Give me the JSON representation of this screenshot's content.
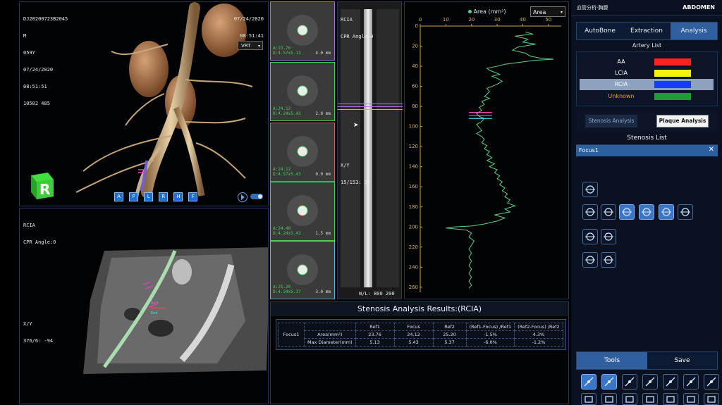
{
  "vrt": {
    "patient_id": "DJ20200723B2045",
    "sex": "M",
    "age": "059Y",
    "date_left": "07/24/2020",
    "time_left": "08:51:51",
    "series": "10502 485",
    "date_right": "07/24/2020",
    "time_right": "08:51:41",
    "mode_select": "VRT",
    "orientation_buttons": [
      "A",
      "P",
      "L",
      "R",
      "H",
      "F"
    ],
    "cube_label": "R"
  },
  "cpr_left": {
    "title": "RCIA",
    "angle": "CPR Angle:0",
    "xy_label": "X/Y",
    "xy_value": "376/6: -94",
    "marker_labels": [
      "Ref1",
      "Stenosis",
      "End"
    ]
  },
  "cross_sections": [
    {
      "line1": "A:23.76",
      "line2": "D:4.57x5.13",
      "mm": "4.0 mm"
    },
    {
      "line1": "A:24.12",
      "line2": "D:4.24x5.43",
      "mm": "2.0 mm"
    },
    {
      "line1": "A:24.12",
      "line2": "D:4.57x5.43",
      "mm": "0.0 mm"
    },
    {
      "line1": "A:24.48",
      "line2": "D:4.24x5.43",
      "mm": "1.5 mm"
    },
    {
      "line1": "A:25.20",
      "line2": "D:4.24x5.37",
      "mm": "3.0 mm"
    }
  ],
  "cpr_straight": {
    "title": "RCIA",
    "angle": "CPR Angle:0",
    "xy_label": "X/Y",
    "xy_value": "15/153: 32",
    "wl": "W/L: 800 200"
  },
  "graph": {
    "legend": "Area (mm²)",
    "select": "Area",
    "x_ticks": [
      0,
      10,
      20,
      30,
      40,
      50
    ],
    "y_ticks": [
      0,
      20,
      40,
      60,
      80,
      100,
      120,
      140,
      160,
      180,
      200,
      220,
      240,
      260
    ],
    "line_color": "#5fcf8a"
  },
  "chart_data": {
    "type": "line",
    "title": "",
    "xlabel": "Area (mm²)",
    "ylabel": "",
    "xlim": [
      0,
      55
    ],
    "ylim": [
      0,
      265
    ],
    "series": [
      {
        "name": "Area (mm²)",
        "points": [
          [
            41,
            6
          ],
          [
            44,
            8
          ],
          [
            37,
            10
          ],
          [
            42,
            13
          ],
          [
            40,
            16
          ],
          [
            45,
            18
          ],
          [
            38,
            21
          ],
          [
            36,
            24
          ],
          [
            41,
            27
          ],
          [
            43,
            30
          ],
          [
            47,
            32
          ],
          [
            52,
            33
          ],
          [
            45,
            34
          ],
          [
            39,
            36
          ],
          [
            33,
            38
          ],
          [
            30,
            40
          ],
          [
            26,
            42
          ],
          [
            27,
            44
          ],
          [
            29,
            46
          ],
          [
            31,
            48
          ],
          [
            28,
            50
          ],
          [
            30,
            52
          ],
          [
            32,
            55
          ],
          [
            30,
            58
          ],
          [
            28,
            60
          ],
          [
            26,
            62
          ],
          [
            27,
            65
          ],
          [
            26,
            68
          ],
          [
            25,
            70
          ],
          [
            27,
            72
          ],
          [
            24,
            75
          ],
          [
            25,
            78
          ],
          [
            23,
            81
          ],
          [
            24,
            84
          ],
          [
            22,
            87
          ],
          [
            23,
            90
          ],
          [
            25,
            92
          ],
          [
            24,
            95
          ],
          [
            22,
            98
          ],
          [
            23,
            101
          ],
          [
            24,
            104
          ],
          [
            22,
            107
          ],
          [
            24,
            110
          ],
          [
            25,
            113
          ],
          [
            24,
            116
          ],
          [
            26,
            119
          ],
          [
            25,
            122
          ],
          [
            27,
            125
          ],
          [
            26,
            128
          ],
          [
            28,
            131
          ],
          [
            26,
            134
          ],
          [
            29,
            137
          ],
          [
            27,
            140
          ],
          [
            30,
            143
          ],
          [
            29,
            146
          ],
          [
            31,
            149
          ],
          [
            30,
            152
          ],
          [
            32,
            155
          ],
          [
            31,
            158
          ],
          [
            33,
            161
          ],
          [
            32,
            164
          ],
          [
            34,
            167
          ],
          [
            33,
            170
          ],
          [
            35,
            173
          ],
          [
            34,
            176
          ],
          [
            37,
            179
          ],
          [
            33,
            182
          ],
          [
            35,
            185
          ],
          [
            29,
            188
          ],
          [
            33,
            191
          ],
          [
            30,
            194
          ],
          [
            25,
            197
          ],
          [
            20,
            199
          ],
          [
            13,
            200
          ],
          [
            10,
            201
          ],
          [
            14,
            202
          ],
          [
            18,
            203
          ],
          [
            20,
            206
          ],
          [
            19,
            210
          ],
          [
            21,
            214
          ],
          [
            20,
            218
          ],
          [
            19,
            222
          ],
          [
            20,
            226
          ],
          [
            19,
            230
          ],
          [
            20,
            234
          ],
          [
            19,
            238
          ],
          [
            20,
            242
          ],
          [
            19,
            246
          ],
          [
            20,
            250
          ],
          [
            19,
            254
          ],
          [
            20,
            258
          ],
          [
            19,
            261
          ]
        ]
      }
    ],
    "markers": [
      {
        "y": 86,
        "color": "#ff5fd0"
      },
      {
        "y": 89,
        "color": "#b070ff"
      },
      {
        "y": 92,
        "color": "#4fd8f0"
      }
    ]
  },
  "results": {
    "title": "Stenosis Analysis Results:(RCIA)",
    "row_label": "Focus1",
    "columns": [
      "Ref1",
      "Focus",
      "Ref2",
      "(Ref1-Focus) /Ref1",
      "(Ref2-Focus) /Ref2"
    ],
    "rows": [
      {
        "name": "Area(mm²)",
        "values": [
          "23.76",
          "24.12",
          "25.20",
          "-1.5%",
          "4.3%"
        ]
      },
      {
        "name": "Max Diameter(mm)",
        "values": [
          "5.13",
          "5.43",
          "5.37",
          "-6.0%",
          "-1.2%"
        ]
      }
    ]
  },
  "side": {
    "header_left": "血管分析-胸腹",
    "header_right": "ABDOMEN",
    "tabs": [
      "AutoBone",
      "Extraction",
      "Analysis"
    ],
    "artery_list_title": "Artery List",
    "arteries": [
      {
        "name": "AA",
        "color": "#ff2020",
        "name_color": "#ffffff"
      },
      {
        "name": "LCIA",
        "color": "#f4f010",
        "name_color": "#ffffff"
      },
      {
        "name": "RCIA",
        "color": "#1a3cff",
        "name_color": "#ffffff"
      },
      {
        "name": "Unknown",
        "color": "#1aa030",
        "name_color": "#ff9a2a"
      }
    ],
    "stenosis_analysis_btn": "Stenosis Analysis",
    "plaque_analysis_btn": "Plaque Analysis",
    "stenosis_list_title": "Stenosis List",
    "stenosis_items": [
      "Focus1"
    ],
    "tools_tab": "Tools",
    "save_tab": "Save"
  }
}
